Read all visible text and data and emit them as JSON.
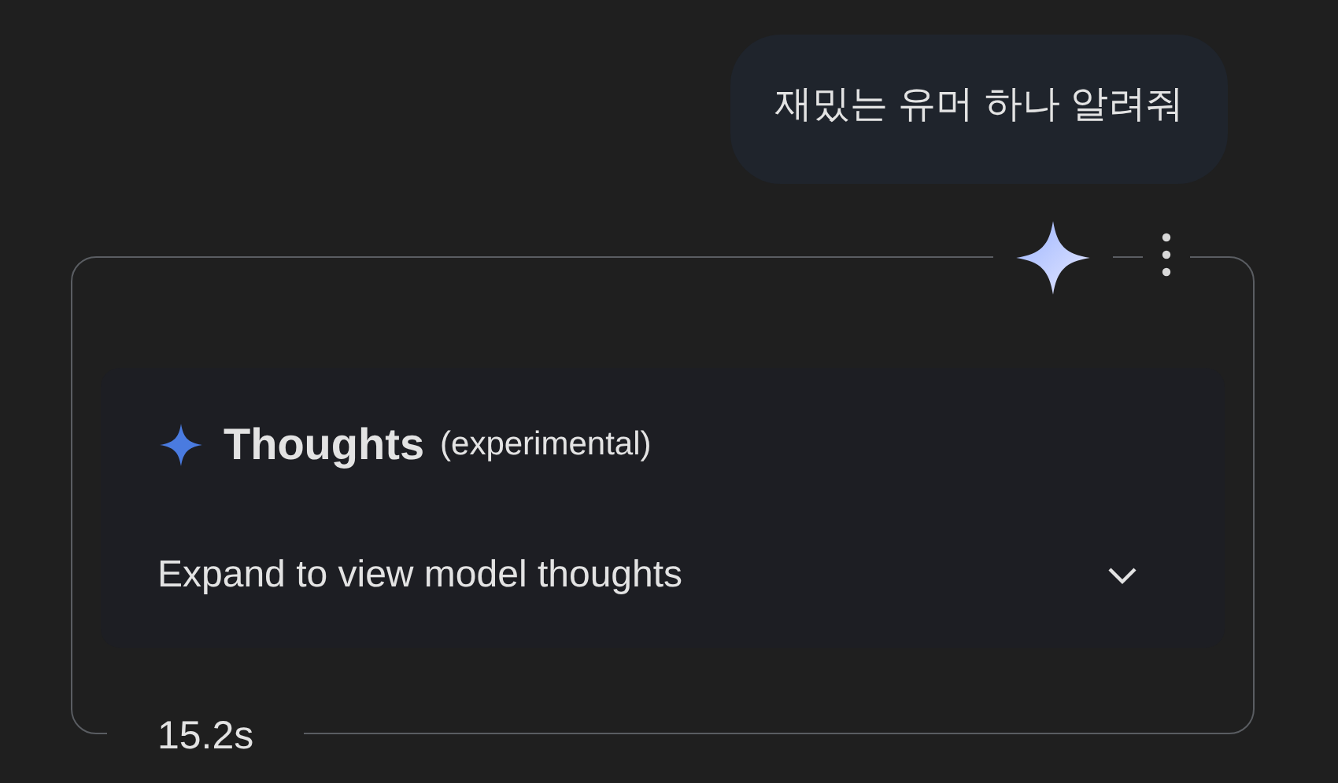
{
  "user_message": {
    "text": "재밌는 유머 하나 알려줘"
  },
  "response": {
    "thoughts": {
      "title": "Thoughts",
      "note": "(experimental)",
      "toggle_label": "Expand to view model thoughts",
      "expanded": false
    },
    "duration": "15.2s"
  }
}
